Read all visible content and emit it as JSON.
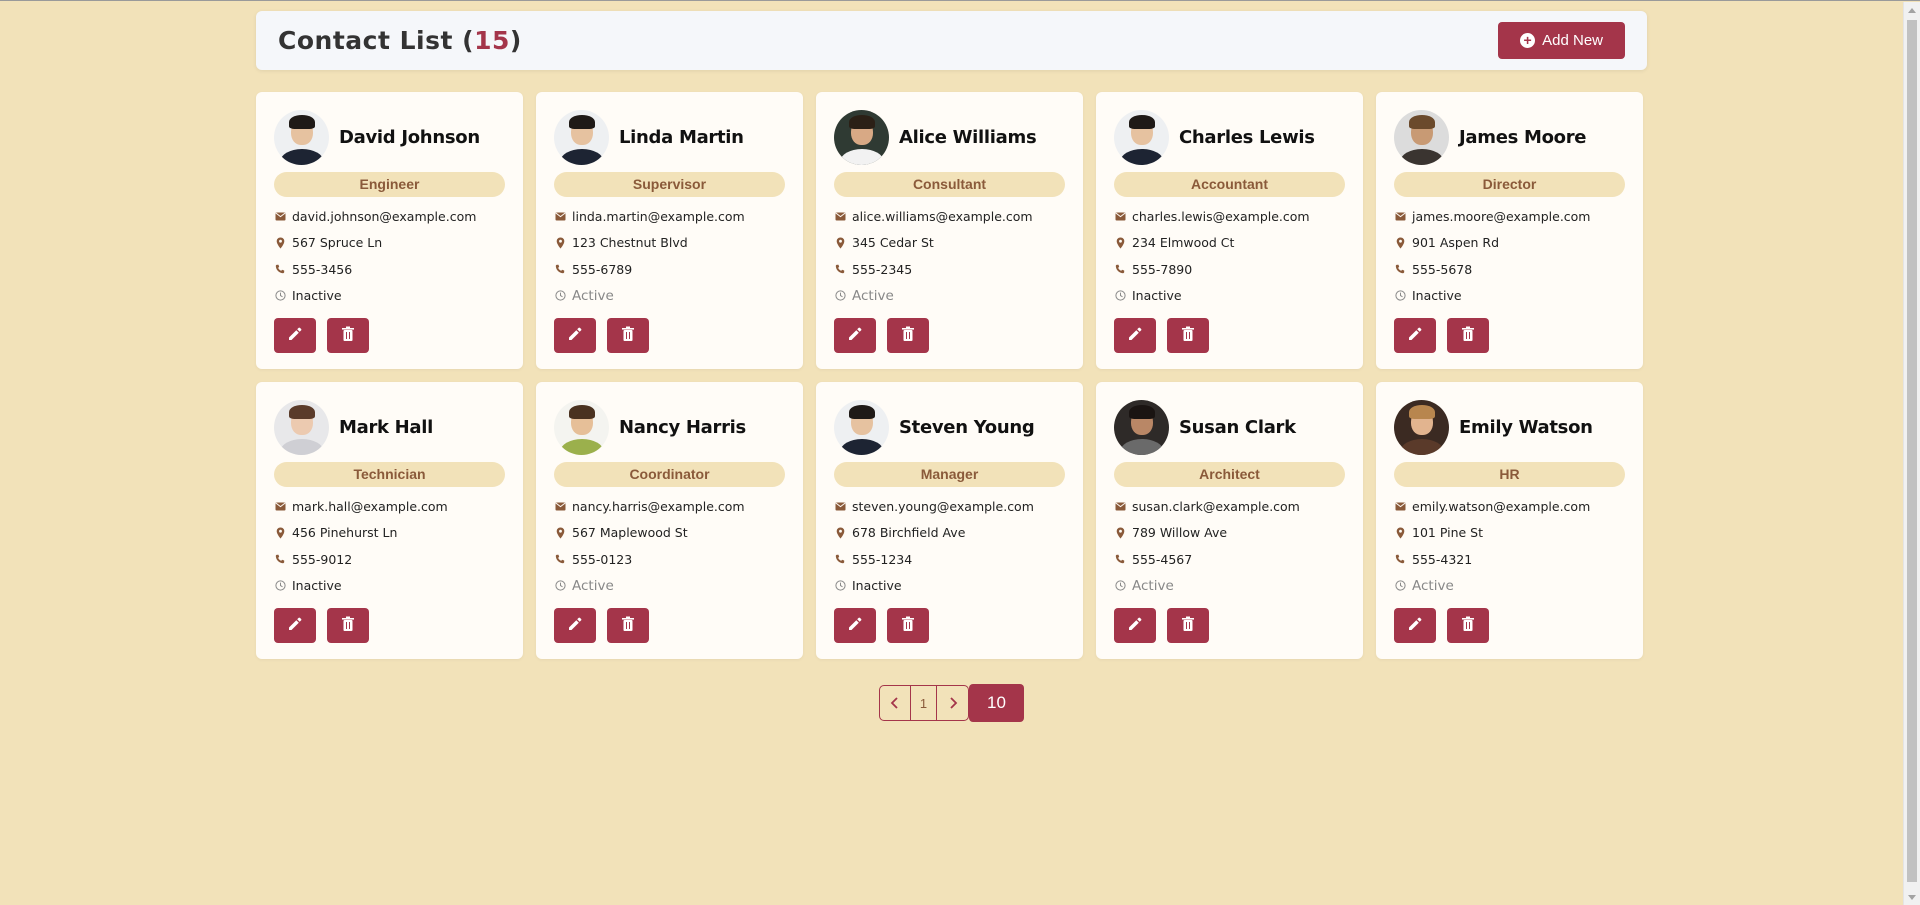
{
  "header": {
    "title": "Contact List",
    "count": "15",
    "add_label": "Add New"
  },
  "colors": {
    "accent": "#a4354a",
    "background": "#f2e2b9",
    "card": "#fffcf7"
  },
  "contacts": [
    {
      "name": "David Johnson",
      "role": "Engineer",
      "email": "david.johnson@example.com",
      "address": "567 Spruce Ln",
      "phone": "555-3456",
      "status": "Inactive",
      "avatar": {
        "bg": "#eef0f2",
        "skin": "#e6c2a0",
        "hair": "#1f1a17",
        "shirt": "#1d2433"
      }
    },
    {
      "name": "Linda Martin",
      "role": "Supervisor",
      "email": "linda.martin@example.com",
      "address": "123 Chestnut Blvd",
      "phone": "555-6789",
      "status": "Active",
      "avatar": {
        "bg": "#eef0f2",
        "skin": "#e6c2a0",
        "hair": "#1f1a17",
        "shirt": "#1d2433"
      }
    },
    {
      "name": "Alice Williams",
      "role": "Consultant",
      "email": "alice.williams@example.com",
      "address": "345 Cedar St",
      "phone": "555-2345",
      "status": "Active",
      "avatar": {
        "bg": "#2f3a33",
        "skin": "#d8a985",
        "hair": "#2b2016",
        "shirt": "#f2f2f2"
      }
    },
    {
      "name": "Charles Lewis",
      "role": "Accountant",
      "email": "charles.lewis@example.com",
      "address": "234 Elmwood Ct",
      "phone": "555-7890",
      "status": "Inactive",
      "avatar": {
        "bg": "#eef0f2",
        "skin": "#e6c2a0",
        "hair": "#1f1a17",
        "shirt": "#1d2433"
      }
    },
    {
      "name": "James Moore",
      "role": "Director",
      "email": "james.moore@example.com",
      "address": "901 Aspen Rd",
      "phone": "555-5678",
      "status": "Inactive",
      "avatar": {
        "bg": "#dcdcdc",
        "skin": "#c89a74",
        "hair": "#6b4a2c",
        "shirt": "#3a3430"
      }
    },
    {
      "name": "Mark Hall",
      "role": "Technician",
      "email": "mark.hall@example.com",
      "address": "456 Pinehurst Ln",
      "phone": "555-9012",
      "status": "Inactive",
      "avatar": {
        "bg": "#e8e8ea",
        "skin": "#eccab0",
        "hair": "#5a3b2a",
        "shirt": "#cfcfd4"
      }
    },
    {
      "name": "Nancy Harris",
      "role": "Coordinator",
      "email": "nancy.harris@example.com",
      "address": "567 Maplewood St",
      "phone": "555-0123",
      "status": "Active",
      "avatar": {
        "bg": "#f4f4f0",
        "skin": "#e6bf98",
        "hair": "#4a3220",
        "shirt": "#9bb04c"
      }
    },
    {
      "name": "Steven Young",
      "role": "Manager",
      "email": "steven.young@example.com",
      "address": "678 Birchfield Ave",
      "phone": "555-1234",
      "status": "Inactive",
      "avatar": {
        "bg": "#eef0f2",
        "skin": "#e6c2a0",
        "hair": "#1f1a17",
        "shirt": "#1d2433"
      }
    },
    {
      "name": "Susan Clark",
      "role": "Architect",
      "email": "susan.clark@example.com",
      "address": "789 Willow Ave",
      "phone": "555-4567",
      "status": "Active",
      "avatar": {
        "bg": "#2e2a28",
        "skin": "#b98766",
        "hair": "#1a1412",
        "shirt": "#6a6a6a"
      }
    },
    {
      "name": "Emily Watson",
      "role": "HR",
      "email": "emily.watson@example.com",
      "address": "101 Pine St",
      "phone": "555-4321",
      "status": "Active",
      "avatar": {
        "bg": "#3b2a22",
        "skin": "#e2b48f",
        "hair": "#b8864e",
        "shirt": "#5a3a2a"
      }
    }
  ],
  "pagination": {
    "current_page": "1",
    "page_size": "10"
  }
}
